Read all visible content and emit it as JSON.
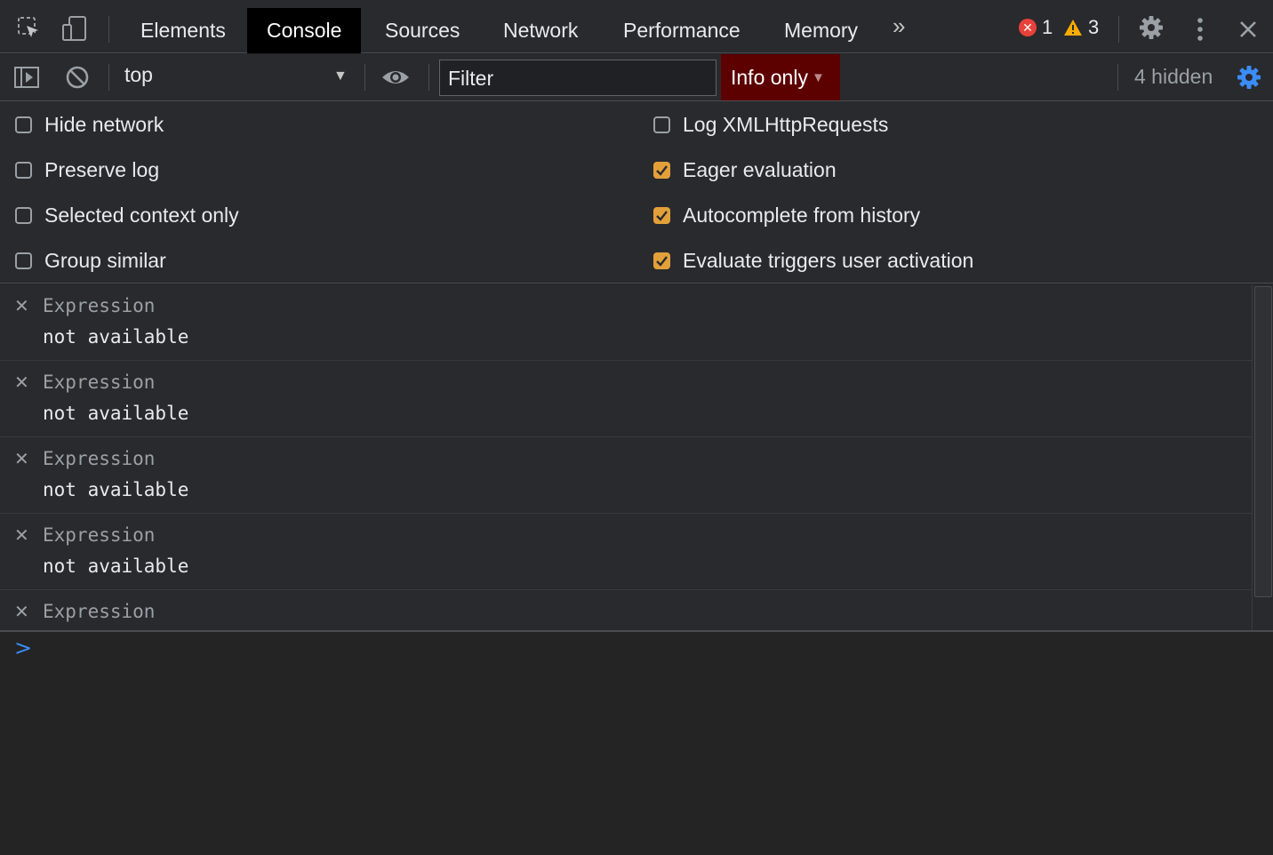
{
  "tabs": [
    "Elements",
    "Console",
    "Sources",
    "Network",
    "Performance",
    "Memory"
  ],
  "active_tab": "Console",
  "more_tabs": "»",
  "errors_count": "1",
  "warnings_count": "3",
  "toolbar": {
    "context": "top",
    "filter_placeholder": "Filter",
    "levels_label": "Info only",
    "hidden_count": "4 hidden"
  },
  "settings": {
    "left": [
      {
        "label": "Hide network",
        "checked": false
      },
      {
        "label": "Preserve log",
        "checked": false
      },
      {
        "label": "Selected context only",
        "checked": false
      },
      {
        "label": "Group similar",
        "checked": false
      }
    ],
    "right": [
      {
        "label": "Log XMLHttpRequests",
        "checked": false
      },
      {
        "label": "Eager evaluation",
        "checked": true
      },
      {
        "label": "Autocomplete from history",
        "checked": true
      },
      {
        "label": "Evaluate triggers user activation",
        "checked": true
      }
    ]
  },
  "watch_expressions": [
    {
      "expression": "Expression",
      "value": "not available"
    },
    {
      "expression": "Expression",
      "value": "not available"
    },
    {
      "expression": "Expression",
      "value": "not available"
    },
    {
      "expression": "Expression",
      "value": "not available"
    },
    {
      "expression": "Expression",
      "value": ""
    }
  ],
  "prompt_symbol": ">",
  "colors": {
    "levels_bg": "#5c0000",
    "checkbox_checked": "#e3a03a",
    "prompt": "#3b8cf7",
    "error": "#e8413a",
    "warning": "#f9ab00"
  }
}
